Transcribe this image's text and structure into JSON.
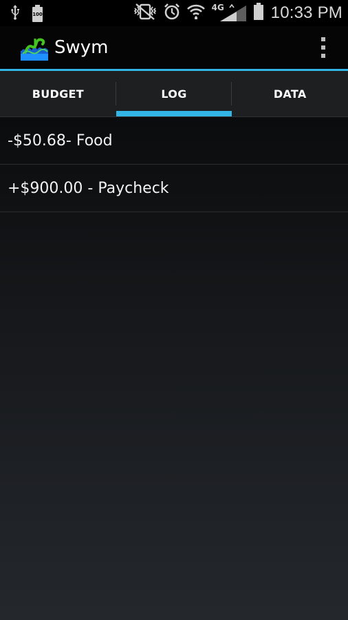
{
  "status_bar": {
    "battery_level_text": "100",
    "time": "10:33 PM",
    "network_label": "4G",
    "icons": [
      "usb-icon",
      "battery-small-icon",
      "vibrate-mute-icon",
      "alarm-icon",
      "wifi-icon",
      "signal-icon",
      "battery-icon"
    ]
  },
  "action_bar": {
    "title": "Swym",
    "logo_icon": "swym-logo-icon",
    "menu_icon": "overflow-menu-icon"
  },
  "tabs": [
    {
      "label": "BUDGET",
      "selected": false
    },
    {
      "label": "LOG",
      "selected": true
    },
    {
      "label": "DATA",
      "selected": false
    }
  ],
  "log": {
    "entries": [
      {
        "text": "-$50.68- Food"
      },
      {
        "text": "+$900.00 - Paycheck"
      }
    ]
  },
  "colors": {
    "accent": "#33b5e5",
    "tab_background": "#1d1f21",
    "action_bar_background": "#050505",
    "logo_green": "#44c21f",
    "logo_blue": "#1e90ff"
  }
}
